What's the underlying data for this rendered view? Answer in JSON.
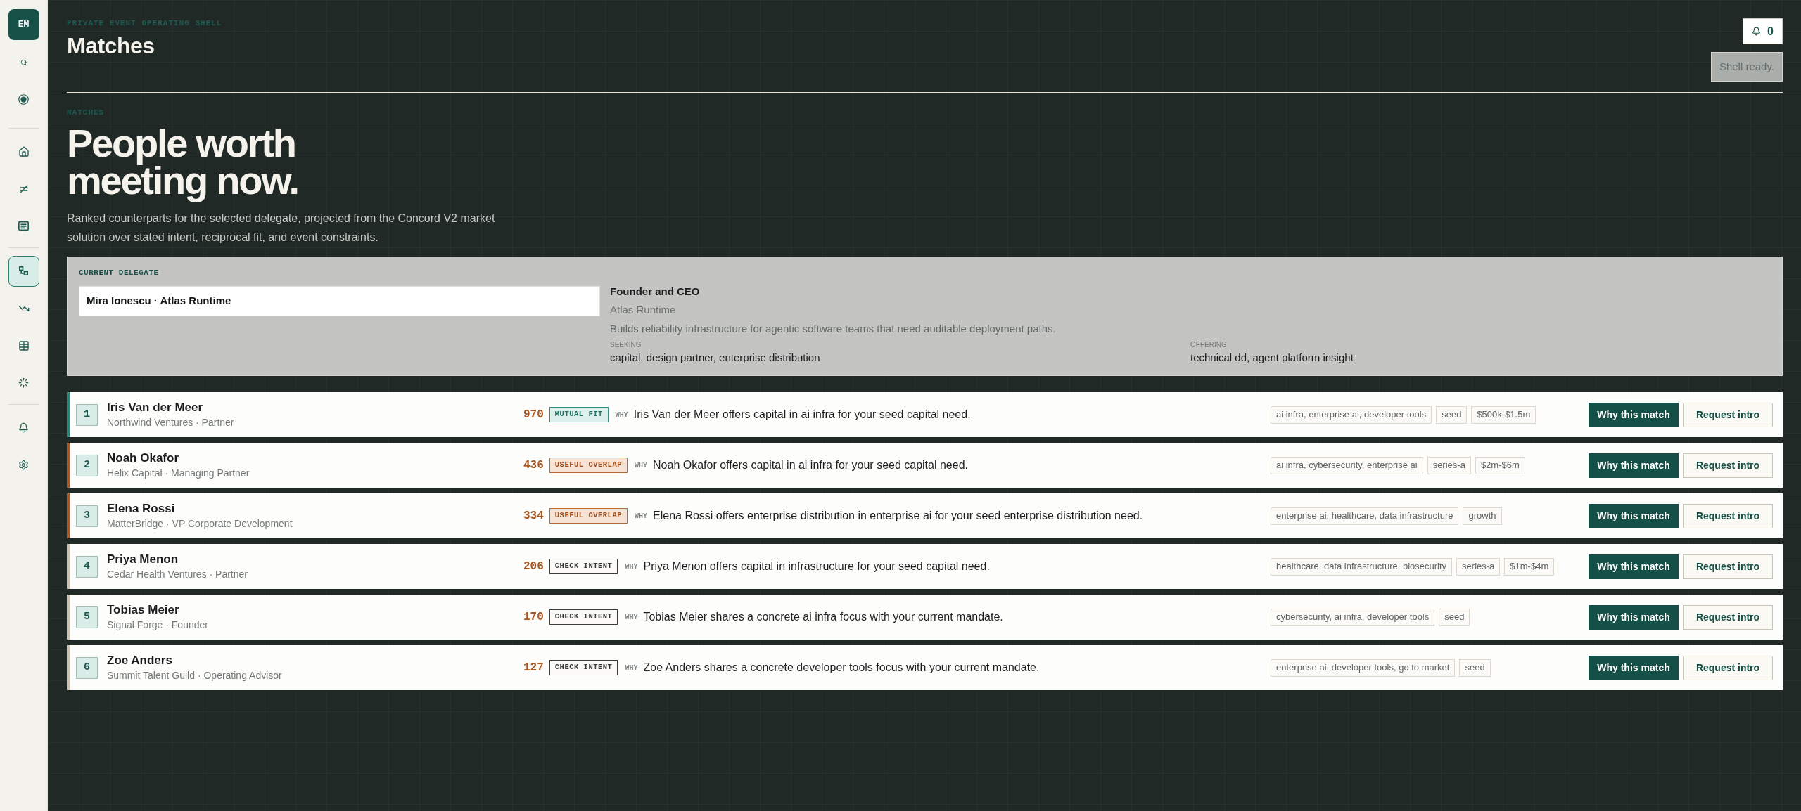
{
  "sidebar": {
    "avatar": "EM",
    "groups": [
      {
        "items": [
          {
            "selected": false
          },
          {
            "selected": false
          }
        ]
      },
      {
        "items": [
          {
            "selected": false
          },
          {
            "selected": false
          },
          {
            "selected": false
          }
        ]
      },
      {
        "items": [
          {
            "selected": true
          },
          {
            "selected": false
          },
          {
            "selected": false
          },
          {
            "selected": false
          }
        ]
      },
      {
        "items": [
          {
            "selected": false
          },
          {
            "selected": false
          }
        ]
      }
    ]
  },
  "header": {
    "eyebrow": "PRIVATE EVENT OPERATING SHELL",
    "title": "Matches",
    "notifications": "0",
    "status": "Shell ready."
  },
  "hero": {
    "eyebrow": "MATCHES",
    "title": "People worth meeting now.",
    "description": "Ranked counterparts for the selected delegate, projected from the Concord V2 market solution over stated intent, reciprocal fit, and event constraints."
  },
  "delegate": {
    "label": "CURRENT DELEGATE",
    "value": "Mira Ionescu · Atlas Runtime",
    "role": "Founder and CEO",
    "company": "Atlas Runtime",
    "bio": "Builds reliability infrastructure for agentic software teams that need auditable deployment paths.",
    "seeking_label": "SEEKING",
    "seeking": "capital, design partner, enterprise distribution",
    "offering_label": "OFFERING",
    "offering": "technical dd, agent platform insight"
  },
  "matches": [
    {
      "rank": "1",
      "name": "Iris Van der Meer",
      "affiliation": "Northwind Ventures · Partner",
      "score": "970",
      "kind": "mutual",
      "fit": "MUTUAL FIT",
      "why": "WHY",
      "reason": "Iris Van der Meer offers capital in ai infra for your seed capital need.",
      "tags": [
        "ai infra, enterprise ai, developer tools",
        "seed",
        "$500k-$1.5m"
      ],
      "actions": [
        "Why this match",
        "Request intro"
      ]
    },
    {
      "rank": "2",
      "name": "Noah Okafor",
      "affiliation": "Helix Capital · Managing Partner",
      "score": "436",
      "kind": "overlap",
      "fit": "USEFUL OVERLAP",
      "why": "WHY",
      "reason": "Noah Okafor offers capital in ai infra for your seed capital need.",
      "tags": [
        "ai infra, cybersecurity, enterprise ai",
        "series-a",
        "$2m-$6m"
      ],
      "actions": [
        "Why this match",
        "Request intro"
      ]
    },
    {
      "rank": "3",
      "name": "Elena Rossi",
      "affiliation": "MatterBridge · VP Corporate Development",
      "score": "334",
      "kind": "overlap",
      "fit": "USEFUL OVERLAP",
      "why": "WHY",
      "reason": "Elena Rossi offers enterprise distribution in enterprise ai for your seed enterprise distribution need.",
      "tags": [
        "enterprise ai, healthcare, data infrastructure",
        "growth"
      ],
      "actions": [
        "Why this match",
        "Request intro"
      ]
    },
    {
      "rank": "4",
      "name": "Priya Menon",
      "affiliation": "Cedar Health Ventures · Partner",
      "score": "206",
      "kind": "check",
      "fit": "CHECK INTENT",
      "why": "WHY",
      "reason": "Priya Menon offers capital in infrastructure for your seed capital need.",
      "tags": [
        "healthcare, data infrastructure, biosecurity",
        "series-a",
        "$1m-$4m"
      ],
      "actions": [
        "Why this match",
        "Request intro"
      ]
    },
    {
      "rank": "5",
      "name": "Tobias Meier",
      "affiliation": "Signal Forge · Founder",
      "score": "170",
      "kind": "check",
      "fit": "CHECK INTENT",
      "why": "WHY",
      "reason": "Tobias Meier shares a concrete ai infra focus with your current mandate.",
      "tags": [
        "cybersecurity, ai infra, developer tools",
        "seed"
      ],
      "actions": [
        "Why this match",
        "Request intro"
      ]
    },
    {
      "rank": "6",
      "name": "Zoe Anders",
      "affiliation": "Summit Talent Guild · Operating Advisor",
      "score": "127",
      "kind": "check",
      "fit": "CHECK INTENT",
      "why": "WHY",
      "reason": "Zoe Anders shares a concrete developer tools focus with your current mandate.",
      "tags": [
        "enterprise ai, developer tools, go to market",
        "seed"
      ],
      "actions": [
        "Why this match",
        "Request intro"
      ]
    }
  ]
}
